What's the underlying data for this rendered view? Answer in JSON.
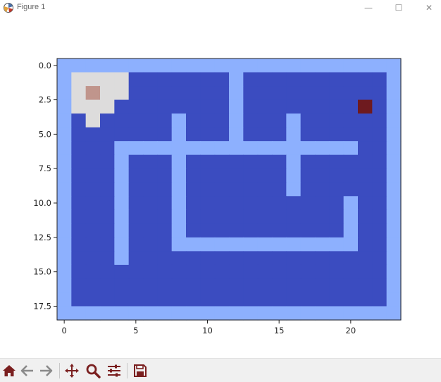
{
  "window": {
    "title": "Figure 1",
    "controls": {
      "minimize": "—",
      "maximize": "☐",
      "close": "✕"
    }
  },
  "plot": {
    "x_ticks": [
      "0",
      "5",
      "10",
      "15",
      "20"
    ],
    "y_ticks": [
      "0.0",
      "2.5",
      "5.0",
      "7.5",
      "10.0",
      "12.5",
      "15.0",
      "17.5"
    ],
    "colors": {
      "wall": "#8db0fe",
      "floor": "#3b4cc0",
      "visited": "#dddcdc",
      "agent": "#c0958c",
      "goal": "#6e1a1f"
    }
  },
  "toolbar": {
    "tools": [
      {
        "name": "home-icon",
        "tooltip": "Home"
      },
      {
        "name": "back-icon",
        "tooltip": "Back"
      },
      {
        "name": "forward-icon",
        "tooltip": "Forward"
      },
      {
        "name": "pan-icon",
        "tooltip": "Pan"
      },
      {
        "name": "zoom-icon",
        "tooltip": "Zoom"
      },
      {
        "name": "configure-subplots-icon",
        "tooltip": "Subplots"
      },
      {
        "name": "save-icon",
        "tooltip": "Save"
      }
    ]
  }
}
